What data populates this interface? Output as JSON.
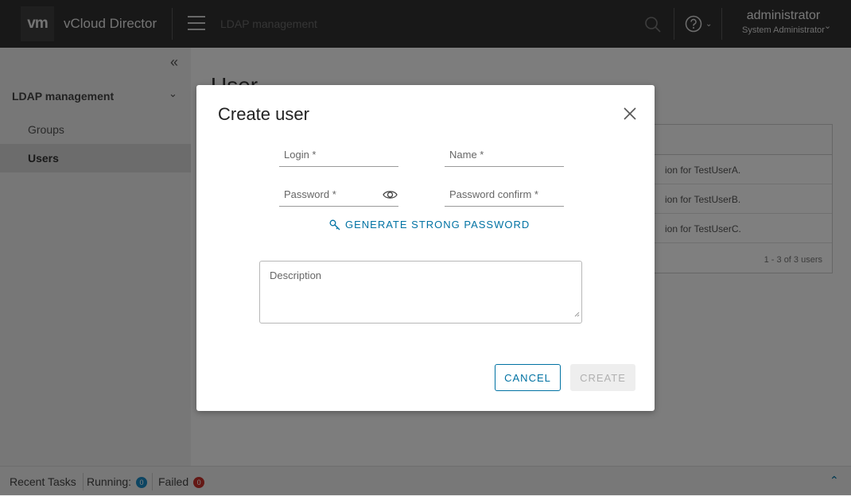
{
  "header": {
    "logo": "vm",
    "app_name": "vCloud Director",
    "page": "LDAP management",
    "user_name": "administrator",
    "user_role": "System Administrator"
  },
  "sidebar": {
    "section": "LDAP management",
    "items": [
      {
        "label": "Groups"
      },
      {
        "label": "Users"
      }
    ]
  },
  "main": {
    "heading": "User",
    "rows": [
      "ion for TestUserA.",
      "ion for TestUserB.",
      "ion for TestUserC."
    ],
    "pagination": "1 - 3 of 3 users"
  },
  "footer": {
    "recent_tasks": "Recent Tasks",
    "running_label": "Running:",
    "running_count": "0",
    "failed_label": "Failed",
    "failed_count": "0"
  },
  "modal": {
    "title": "Create user",
    "login_placeholder": "Login *",
    "name_placeholder": "Name *",
    "password_placeholder": "Password *",
    "password_confirm_placeholder": "Password confirm *",
    "generate_label": "GENERATE STRONG PASSWORD",
    "description_placeholder": "Description",
    "cancel_label": "CANCEL",
    "create_label": "CREATE"
  },
  "colors": {
    "header_bg": "#313131",
    "accent": "#0072a3",
    "running_badge": "#1a8ac4",
    "failed_badge": "#c8302b"
  }
}
